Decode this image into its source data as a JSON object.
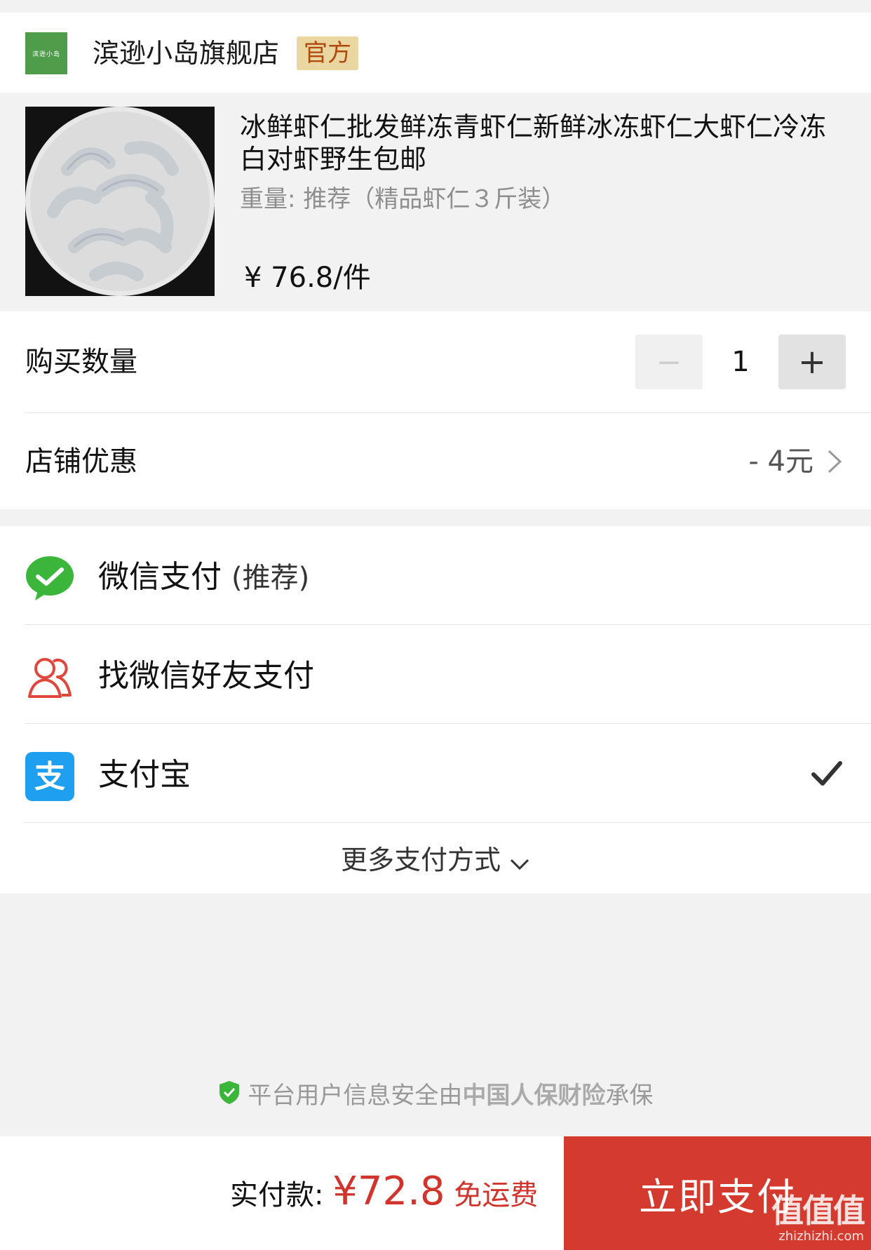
{
  "store": {
    "logo_text": "滨逊小岛",
    "name": "滨逊小岛旗舰店",
    "badge": "官方"
  },
  "product": {
    "title": "冰鲜虾仁批发鲜冻青虾仁新鲜冰冻虾仁大虾仁冷冻白对虾野生包邮",
    "spec": "重量: 推荐（精品虾仁３斤装）",
    "price": "¥ 76.8/件"
  },
  "quantity": {
    "label": "购买数量",
    "minus": "−",
    "value": "1",
    "plus": "+"
  },
  "discount": {
    "label": "店铺优惠",
    "value": "- 4元"
  },
  "payment": {
    "wechat_label": "微信支付",
    "wechat_note": "(推荐)",
    "friend_label": "找微信好友支付",
    "alipay_label": "支付宝",
    "alipay_selected": true,
    "more_label": "更多支付方式"
  },
  "insurance": {
    "prefix": "平台用户信息安全由",
    "insurer": "中国人保财险",
    "suffix": "承保"
  },
  "bottom": {
    "total_label": "实付款:",
    "total_amount": "¥72.8",
    "shipping": "免运费",
    "pay_button": "立即支付"
  },
  "watermark": {
    "big": "值值值",
    "small": "zhizhizhi.com"
  },
  "colors": {
    "accent_red": "#d53a2f",
    "wechat_green": "#3bb53a",
    "alipay_blue": "#1f9ff0",
    "badge_bg": "#ead6a0"
  }
}
